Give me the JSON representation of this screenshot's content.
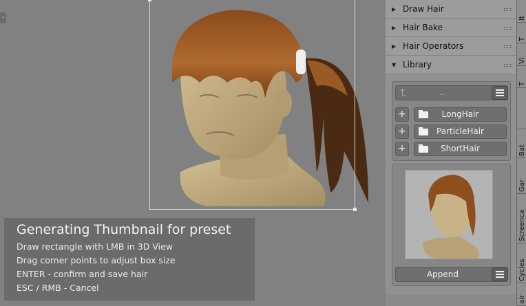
{
  "viewport": {
    "left_toggle_icon": "chevron-right-icon",
    "info": {
      "title": "Generating Thumbnail for preset",
      "lines": [
        "Draw rectangle with LMB in 3D View",
        "Drag corner points to adjust box size",
        "ENTER - confirm and save hair",
        "ESC / RMB - Cancel"
      ]
    }
  },
  "panel": {
    "sections": [
      {
        "label": "Draw Hair",
        "expanded": false
      },
      {
        "label": "Hair Bake",
        "expanded": false
      },
      {
        "label": "Hair Operators",
        "expanded": false
      },
      {
        "label": "Library",
        "expanded": true
      }
    ],
    "library": {
      "path_label": "..",
      "folders": [
        "LongHair",
        "ParticleHair",
        "ShortHair"
      ],
      "append_label": "Append"
    }
  },
  "tabs": [
    "It",
    "T",
    "Vi",
    "T",
    "",
    "Bat",
    "Gar",
    "Screenca",
    "Cycles",
    "air"
  ],
  "colors": {
    "viewport_bg": "#818181",
    "panel_bg": "#8a8a8a",
    "button_bg": "#6f6f6f",
    "hair": "#9a5a25",
    "skin": "#c2aa7e"
  }
}
